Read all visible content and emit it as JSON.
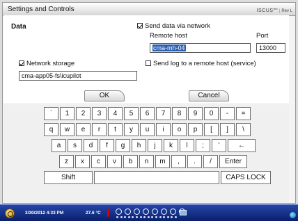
{
  "window": {
    "title": "Settings and Controls",
    "brand_name": "ISCUS",
    "brand_sup": "flex",
    "brand_rev": "Rev L"
  },
  "settings": {
    "section_label": "Data",
    "send_data_label": "Send data via network",
    "send_data_checked": true,
    "remote_host_label": "Remote host",
    "remote_host_value": "cma-mh-04",
    "port_label": "Port",
    "port_value": "13000",
    "network_storage_label": "Network storage",
    "network_storage_checked": true,
    "network_storage_path": "cma-app05-fs\\icupilot",
    "send_log_label": "Send log to a remote host (service)",
    "send_log_checked": false,
    "ok_label": "OK",
    "cancel_label": "Cancel"
  },
  "keyboard": {
    "row1": [
      "`",
      "1",
      "2",
      "3",
      "4",
      "5",
      "6",
      "7",
      "8",
      "9",
      "0",
      "-",
      "="
    ],
    "row2": [
      "q",
      "w",
      "e",
      "r",
      "t",
      "y",
      "u",
      "i",
      "o",
      "p",
      "[",
      "]",
      "\\"
    ],
    "row3": [
      "a",
      "s",
      "d",
      "f",
      "g",
      "h",
      "j",
      "k",
      "l",
      ";",
      "'",
      "←"
    ],
    "row4": [
      "z",
      "x",
      "c",
      "v",
      "b",
      "n",
      "m",
      ",",
      ".",
      "/",
      "Enter"
    ],
    "shift_label": "Shift",
    "space_label": "",
    "caps_label": "CAPS LOCK"
  },
  "status": {
    "datetime": "3/30/2012 4:33 PM",
    "temperature": "27.6 °C",
    "power_icon": "power-icon",
    "network_icon": "monitor-icon"
  }
}
